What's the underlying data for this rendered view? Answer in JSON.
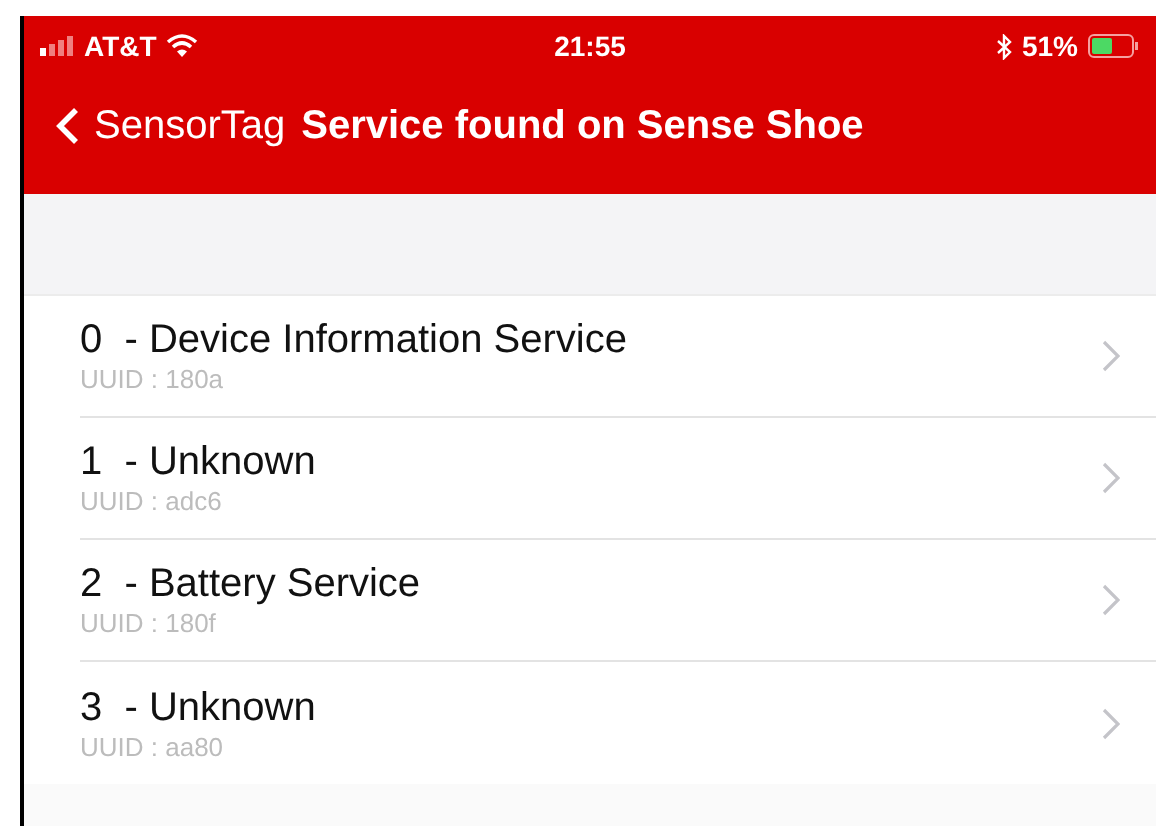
{
  "status_bar": {
    "carrier": "AT&T",
    "time": "21:55",
    "battery": "51%"
  },
  "nav_bar": {
    "back": "SensorTag",
    "title": "Service found on Sense Shoe"
  },
  "services": [
    {
      "title": "0  - Device Information Service",
      "subtitle": "UUID : 180a"
    },
    {
      "title": "1  - Unknown",
      "subtitle": "UUID : adc6"
    },
    {
      "title": "2  - Battery Service",
      "subtitle": "UUID : 180f"
    },
    {
      "title": "3  - Unknown",
      "subtitle": "UUID : aa80"
    }
  ]
}
